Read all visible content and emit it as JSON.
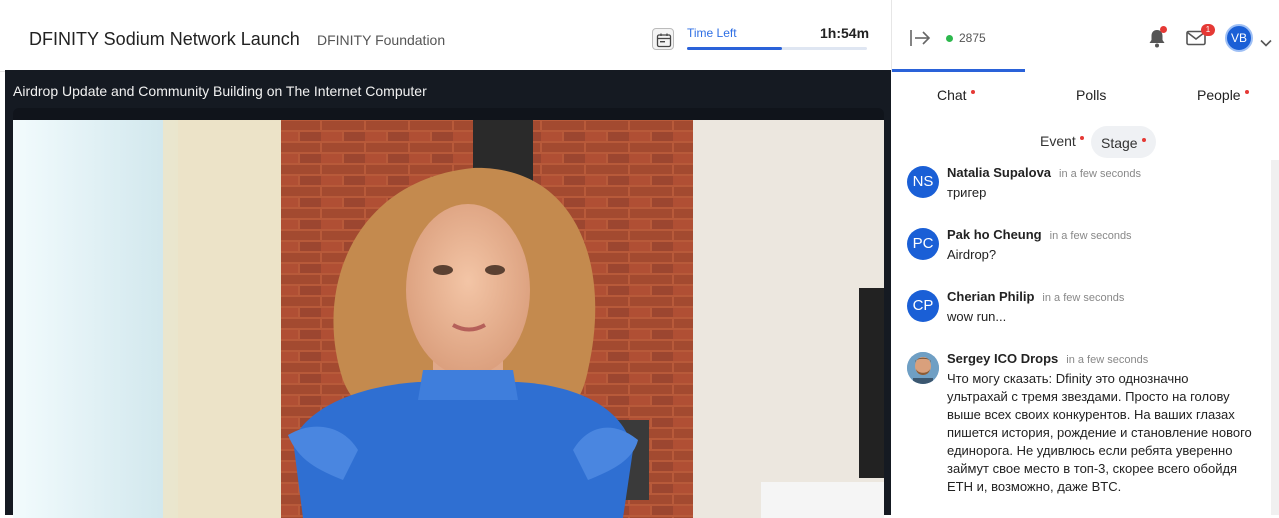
{
  "event": {
    "title": "DFINITY Sodium Network Launch",
    "organizer": "DFINITY Foundation",
    "time_left_label": "Time Left",
    "time_left_value": "1h:54m",
    "time_left_progress": 0.53
  },
  "top_right": {
    "online_count": "2875",
    "mail_badge": "1",
    "user_initials": "VB"
  },
  "video": {
    "session_title": "Airdrop Update and Community Building on The Internet Computer"
  },
  "tabs": [
    {
      "label": "Chat",
      "dot": true
    },
    {
      "label": "Polls",
      "dot": false
    },
    {
      "label": "People",
      "dot": true
    }
  ],
  "subtabs": [
    {
      "label": "Event",
      "dot": true
    },
    {
      "label": "Stage",
      "dot": true
    }
  ],
  "messages": [
    {
      "initials": "NS",
      "name": "Natalia Supalova",
      "time": "in a few seconds",
      "text": "тригер"
    },
    {
      "initials": "PC",
      "name": "Pak ho Cheung",
      "time": "in a few seconds",
      "text": "Airdrop?"
    },
    {
      "initials": "CP",
      "name": "Cherian Philip",
      "time": "in a few seconds",
      "text": "wow run..."
    },
    {
      "initials": "",
      "name": "Sergey ICO Drops",
      "time": "in a few seconds",
      "text": "Что могу сказать: Dfinity это однозначно ультрахай с тремя звездами. Просто на голову выше всех своих конкурентов. На ваших глазах пишется история, рождение и становление нового единорога. Не удивлюсь если ребята уверенно займут свое место в топ-3, скорее всего обойдя ETH и, возможно, даже BTC."
    }
  ],
  "colors": {
    "accent": "#2a62d9",
    "online": "#2db84d",
    "badge": "#e53935"
  }
}
